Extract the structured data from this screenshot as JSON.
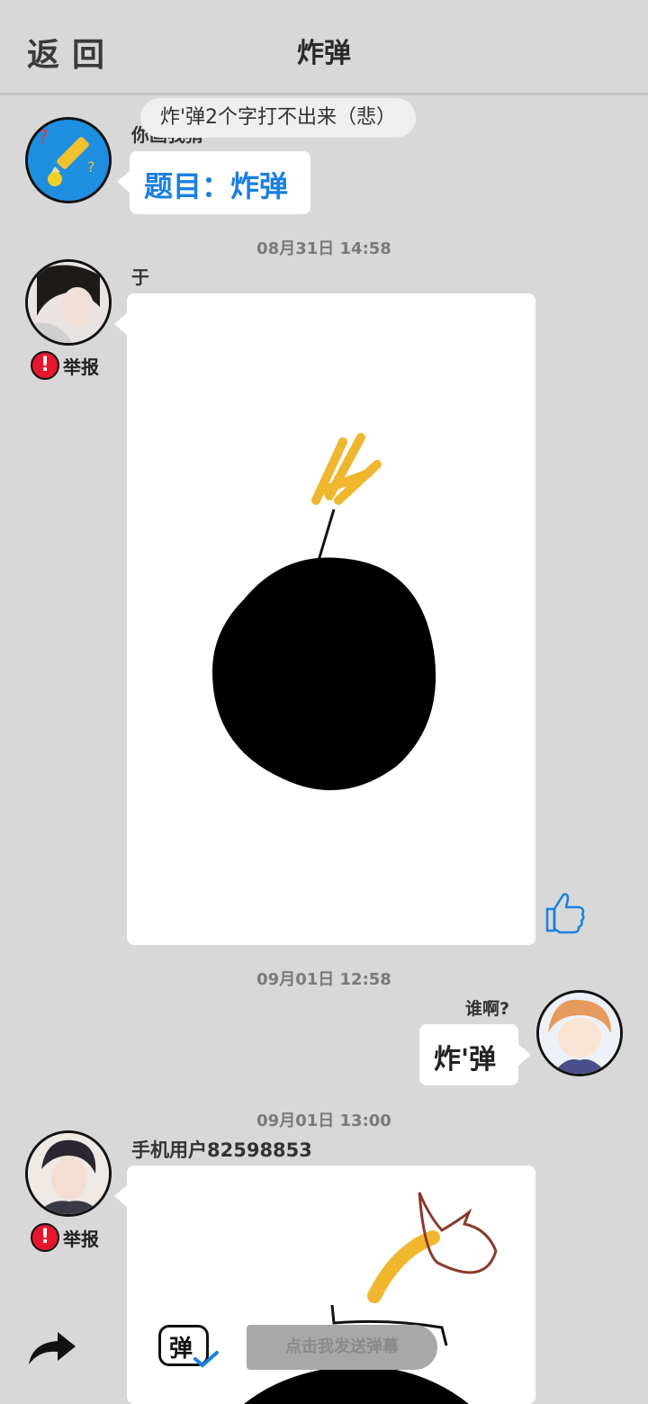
{
  "header": {
    "back_label": "返回",
    "title": "炸弹"
  },
  "danmaku_overlay": "炸'弹2个字打不出来（悲）",
  "topic_message": {
    "sender": "你画我猜",
    "text": "题目：炸弹"
  },
  "messages": [
    {
      "timestamp": "08月31日  14:58",
      "sender": "于",
      "report_label": "举报"
    },
    {
      "timestamp": "09月01日  12:58",
      "sender": "谁啊?",
      "text": "炸'弹"
    },
    {
      "timestamp": "09月01日  13:00",
      "sender": "手机用户82598853",
      "report_label": "举报"
    }
  ],
  "bottom_bar": {
    "danmaku_toggle_label": "弹",
    "danmaku_placeholder": "点击我发送弹幕"
  },
  "colors": {
    "accent": "#1a7fe0",
    "report": "#e6162d",
    "background": "#d8d8d8"
  }
}
